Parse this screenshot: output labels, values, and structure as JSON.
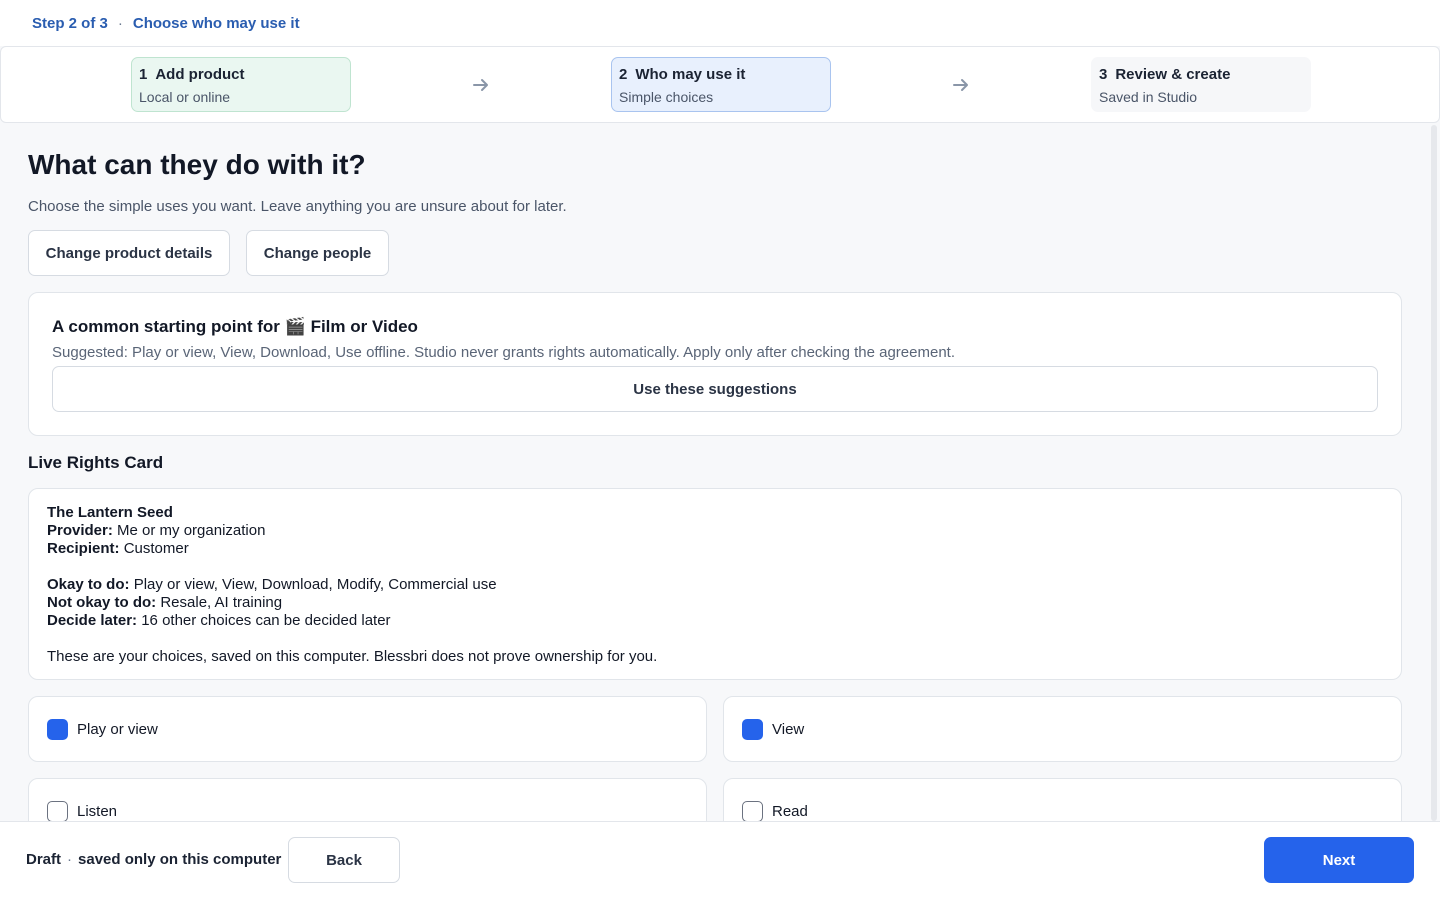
{
  "header": {
    "step_indicator": "Step 2 of 3",
    "separator": "·",
    "step_title": "Choose who may use it"
  },
  "stepper": {
    "steps": [
      {
        "number": "1",
        "title": "Add product",
        "subtitle": "Local or online",
        "state": "complete"
      },
      {
        "number": "2",
        "title": "Who may use it",
        "subtitle": "Simple choices",
        "state": "current"
      },
      {
        "number": "3",
        "title": "Review & create",
        "subtitle": "Saved in Studio",
        "state": "upcoming"
      }
    ],
    "arrow_icon": "arrow-right-icon"
  },
  "main": {
    "heading": "What can they do with it?",
    "intro": "Choose the simple uses you want. Leave anything you are unsure about for later.",
    "change_product_label": "Change product details",
    "change_people_label": "Change people"
  },
  "suggestions": {
    "title_prefix": "A common starting point for",
    "category_icon": "🎬",
    "category": "Film or Video",
    "text": "Suggested: Play or view, View, Download, Use offline. Studio never grants rights automatically. Apply only after checking the agreement.",
    "button_label": "Use these suggestions"
  },
  "rights_card": {
    "section_title": "Live Rights Card",
    "product_name": "The Lantern Seed",
    "provider_label": "Provider:",
    "provider_value": "Me or my organization",
    "recipient_label": "Recipient:",
    "recipient_value": "Customer",
    "okay_label": "Okay to do:",
    "okay_value": "Play or view, View, Download, Modify, Commercial use",
    "not_okay_label": "Not okay to do:",
    "not_okay_value": "Resale, AI training",
    "later_label": "Decide later:",
    "later_value": "16 other choices can be decided later",
    "disclaimer": "These are your choices, saved on this computer. Blessbri does not prove ownership for you."
  },
  "options": [
    {
      "label": "Play or view",
      "checked": true
    },
    {
      "label": "View",
      "checked": true
    },
    {
      "label": "Listen",
      "checked": false
    },
    {
      "label": "Read",
      "checked": false
    }
  ],
  "footer": {
    "draft_label": "Draft",
    "separator": "·",
    "draft_status": "saved only on this computer",
    "back_label": "Back",
    "next_label": "Next"
  },
  "colors": {
    "accent": "#2563eb",
    "header_text": "#2a5db0",
    "step_complete_bg": "#eaf7f1",
    "step_current_bg": "#e8f0fd"
  }
}
